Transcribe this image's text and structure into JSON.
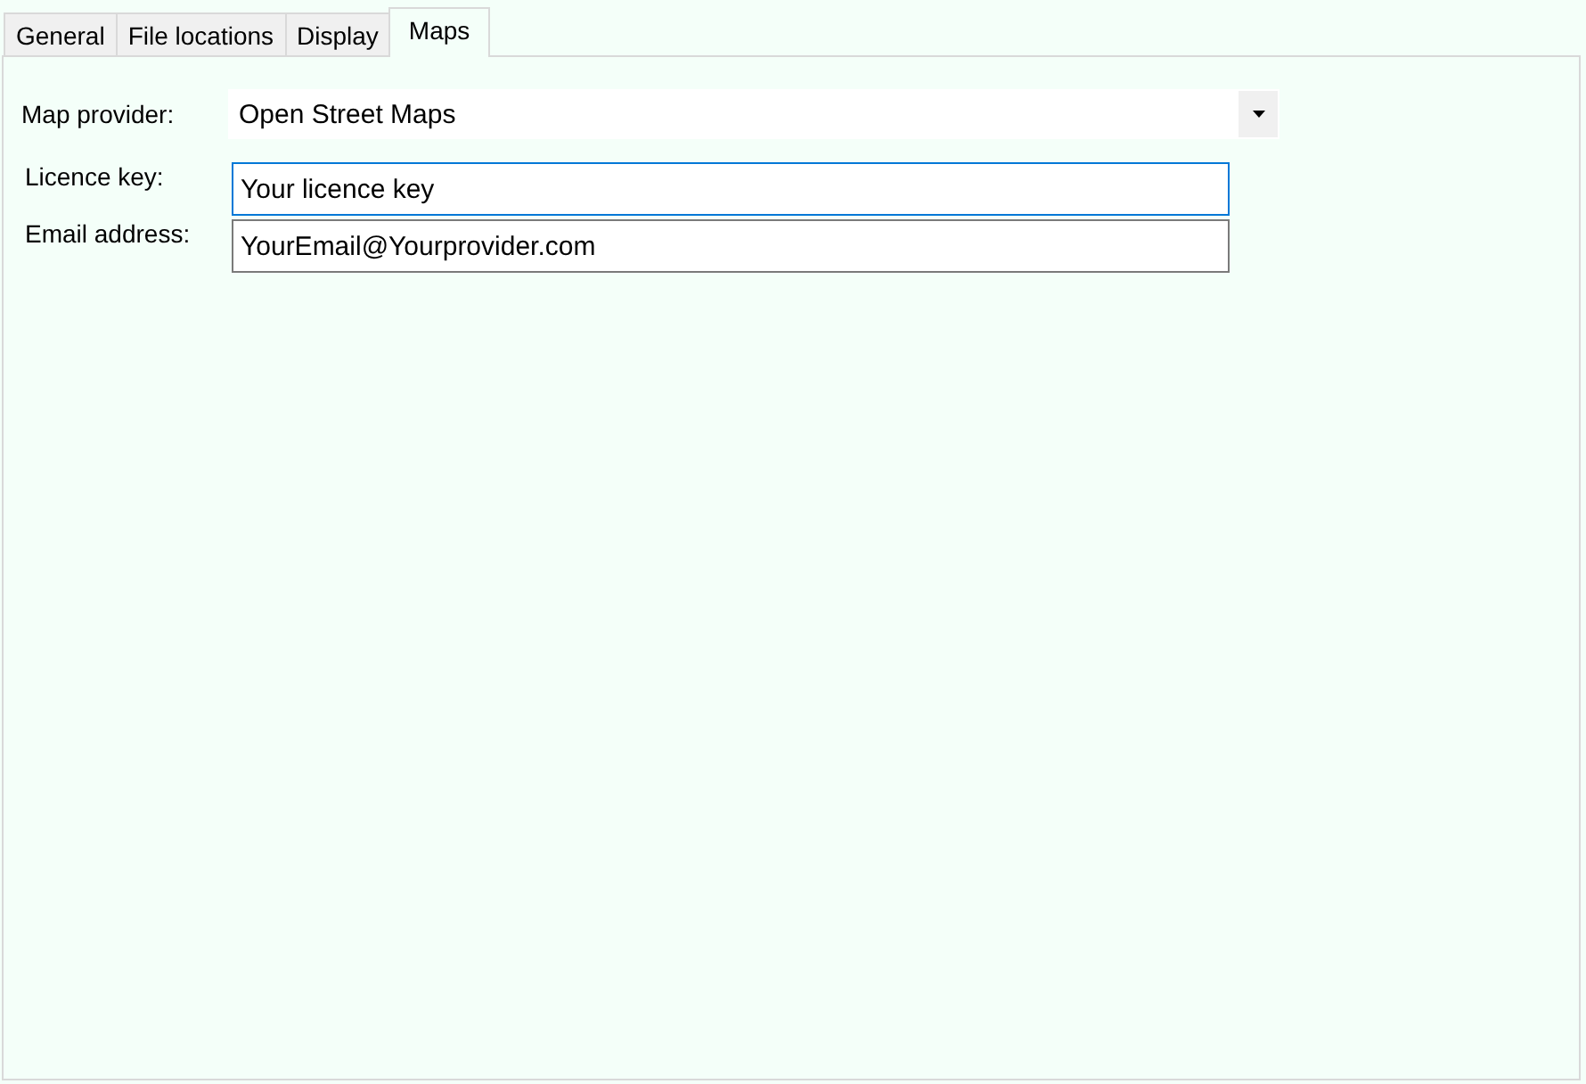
{
  "tabs": [
    {
      "label": "General",
      "selected": false
    },
    {
      "label": "File locations",
      "selected": false
    },
    {
      "label": "Display",
      "selected": false
    },
    {
      "label": "Maps",
      "selected": true
    }
  ],
  "map_provider": {
    "label": "Map provider:",
    "value": "Open Street Maps"
  },
  "fields": [
    {
      "label": "Licence key:",
      "value": "Your licence key",
      "focused": true
    },
    {
      "label": "Email address:",
      "value": "YourEmail@Yourprovider.com",
      "focused": false
    }
  ]
}
